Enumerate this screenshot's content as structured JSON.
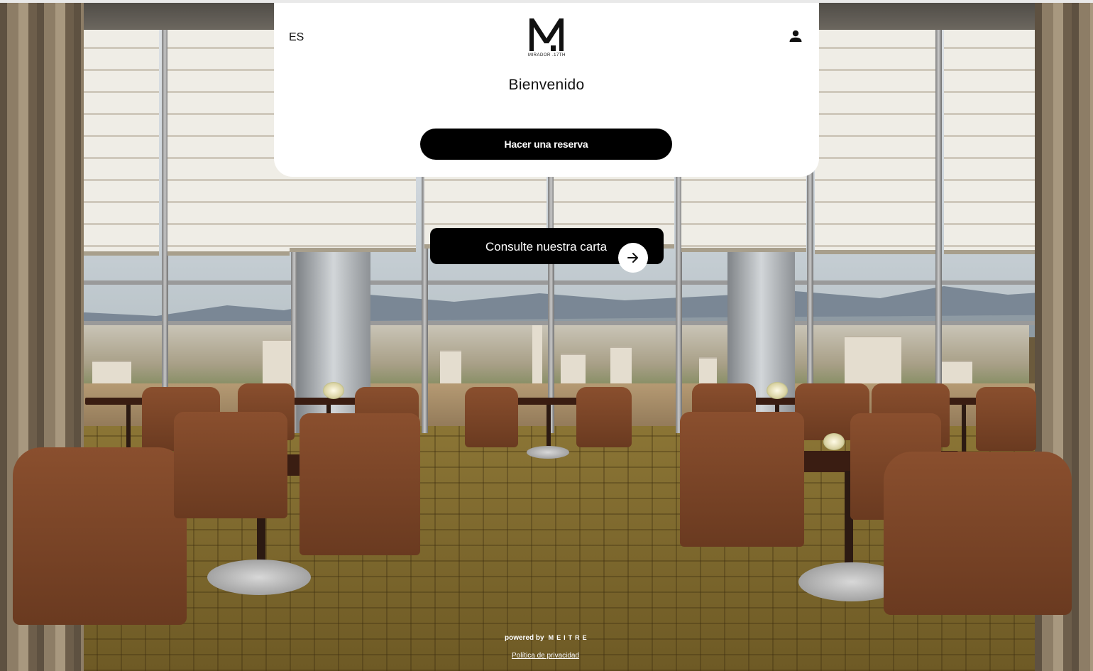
{
  "header": {
    "language": "ES",
    "logo_letter": "M",
    "logo_caption": "MIRADOR .17TH",
    "user_icon": "person-icon"
  },
  "main": {
    "welcome": "Bienvenido",
    "reserve_button": "Hacer una reserva",
    "menu_button": "Consulte nuestra carta",
    "menu_icon": "arrow-right-icon"
  },
  "footer": {
    "powered_by": "powered by",
    "brand": "MEITRE",
    "privacy_link": "Política de privacidad"
  },
  "colors": {
    "button_bg": "#000000",
    "card_bg": "#ffffff",
    "text": "#111111"
  }
}
